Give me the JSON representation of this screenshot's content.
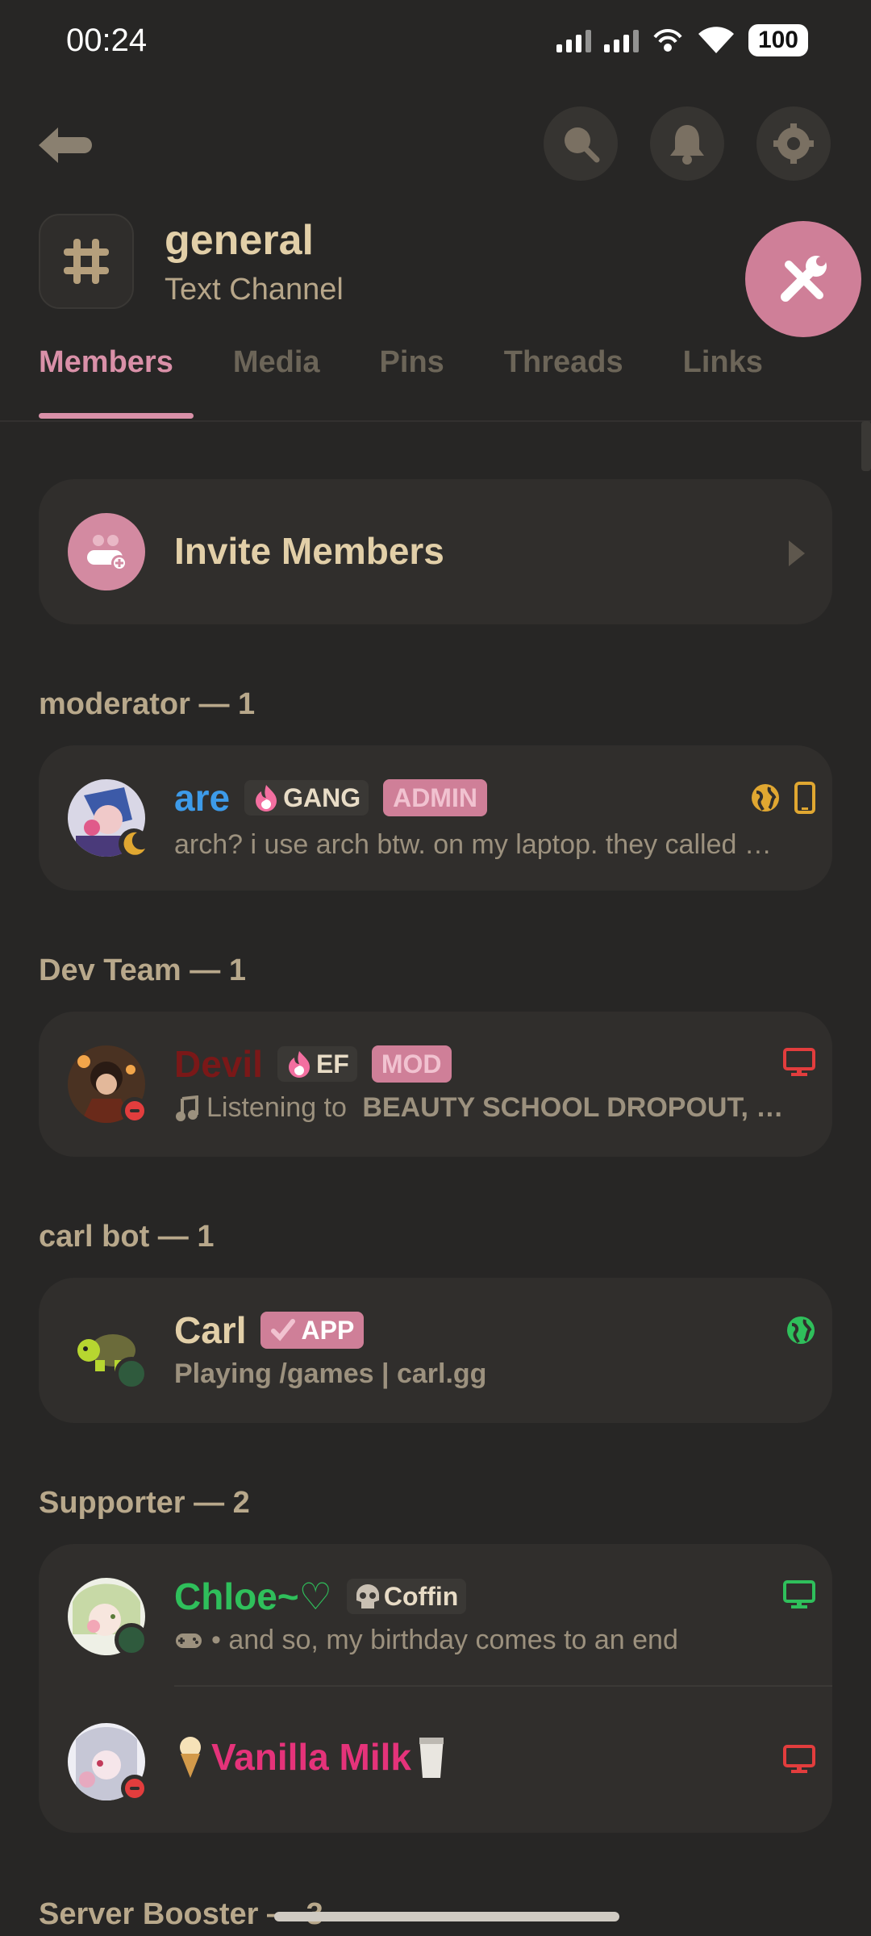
{
  "status_bar": {
    "time": "00:24",
    "battery": "100"
  },
  "channel": {
    "name": "general",
    "type": "Text Channel"
  },
  "tabs": [
    {
      "label": "Members",
      "active": true
    },
    {
      "label": "Media",
      "active": false
    },
    {
      "label": "Pins",
      "active": false
    },
    {
      "label": "Threads",
      "active": false
    },
    {
      "label": "Links",
      "active": false
    }
  ],
  "invite": {
    "label": "Invite Members"
  },
  "sections": [
    {
      "title": "moderator — 1",
      "members": [
        {
          "name": "are",
          "name_color": "#3d9be9",
          "tag_label": "GANG",
          "badge": "ADMIN",
          "subtitle": "arch? i use arch btw. on my laptop. they called …",
          "status": "idle",
          "devices": [
            "web",
            "mobile"
          ]
        }
      ]
    },
    {
      "title": "Dev Team — 1",
      "members": [
        {
          "name": "Devil",
          "name_color": "#7a1818",
          "tag_label": "EF",
          "badge": "MOD",
          "subtitle_prefix": "Listening to ",
          "subtitle_bold": "BEAUTY SCHOOL DROPOUT, …",
          "status": "dnd",
          "devices": [
            "desktop"
          ]
        }
      ]
    },
    {
      "title": "carl bot — 1",
      "members": [
        {
          "name": "Carl",
          "name_color": "#e2cfa8",
          "badge": "APP",
          "subtitle": "Playing /games | carl.gg",
          "status": "online",
          "devices": [
            "web"
          ]
        }
      ]
    },
    {
      "title": "Supporter — 2",
      "members": [
        {
          "name": "Chloe~♡",
          "name_color": "#2fbf5b",
          "tag_label": "Coffin",
          "subtitle": "• and so, my birthday comes to an end",
          "status": "online",
          "devices": [
            "desktop"
          ]
        },
        {
          "name": "Vanilla Milk",
          "name_color": "#e5337a",
          "status": "dnd",
          "devices": [
            "desktop"
          ]
        }
      ]
    },
    {
      "title": "Server Booster — 3",
      "members": []
    }
  ],
  "colors": {
    "accent": "#d990a8",
    "online": "#2fbf5b",
    "idle": "#e0a731",
    "dnd": "#e23d3d"
  }
}
